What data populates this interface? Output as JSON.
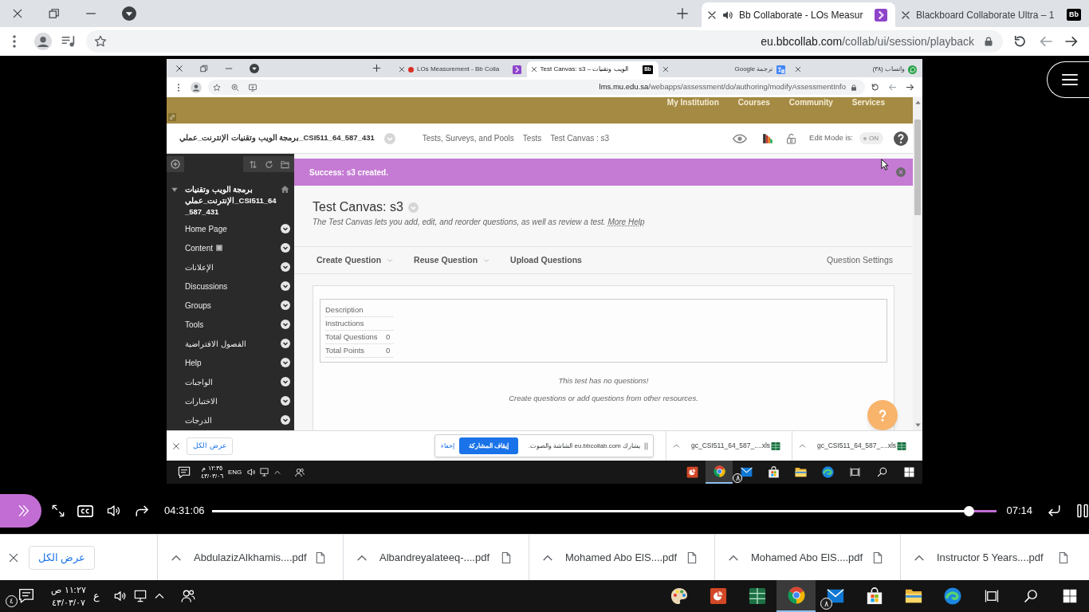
{
  "browser": {
    "tabs": [
      {
        "kind": "blackboard",
        "logo": "Bb",
        "title": "Blackboard Collaborate Ultra – 1",
        "audio": false,
        "selected": false
      },
      {
        "kind": "collab",
        "title": "Bb Collaborate - LOs Measur",
        "audio": true,
        "selected": true
      }
    ],
    "address": {
      "host": "eu.bbcollab.com",
      "path": "/collab/ui/session/playback"
    }
  },
  "shared_screen": {
    "browser": {
      "tabs": [
        {
          "kind": "chat",
          "title": "واتساب (٣٨)",
          "recording": false,
          "selected": false
        },
        {
          "kind": "translate",
          "title": "ترجمة Google",
          "recording": false,
          "selected": false
        },
        {
          "kind": "blackboard",
          "logo": "Bb",
          "title": "Test Canvas: s3 – الويب وتقنيات",
          "recording": false,
          "selected": true
        },
        {
          "kind": "collab",
          "title": "LOs Measurement - Bb Colla",
          "recording": true,
          "selected": false
        }
      ],
      "address": {
        "host": "lms.mu.edu.sa",
        "path": "/webapps/assessment/do/authoring/modifyAssessmentInfo"
      }
    },
    "page": {
      "top_nav": [
        "Services",
        "Community",
        "Courses",
        "My Institution"
      ],
      "breadcrumbs": [
        {
          "kind": "page",
          "label": "Test Canvas : s3"
        },
        {
          "kind": "page",
          "label": "Tests"
        },
        {
          "kind": "page",
          "label": "Tests, Surveys, and Pools"
        },
        {
          "kind": "course",
          "label": "برمجة الويب وتقنيات الإنترنت_عملي_CSI511_64_587_431"
        }
      ],
      "edit_mode": {
        "label": "Edit Mode is:",
        "value": "ON"
      },
      "sidebar": {
        "course_title": "برمجة الويب وتقنيات الإنترنت_عملي_CSI511_64_587_431",
        "items": [
          {
            "label": "Home Page",
            "hidden": false
          },
          {
            "label": "Content",
            "hidden": true
          },
          {
            "label": "الإعلانات",
            "hidden": false
          },
          {
            "label": "Discussions",
            "hidden": false
          },
          {
            "label": "Groups",
            "hidden": false
          },
          {
            "label": "Tools",
            "hidden": false
          },
          {
            "label": "الفصول الافتراضية",
            "hidden": false
          },
          {
            "label": "Help",
            "hidden": false
          },
          {
            "label": "الواجبات",
            "hidden": false
          },
          {
            "label": "الاختبارات",
            "hidden": false
          },
          {
            "label": "الدرجات",
            "hidden": false
          }
        ]
      },
      "notice": "Success: s3 created.",
      "title": "Test Canvas: s3",
      "description": "The Test Canvas lets you add, edit, and reorder questions, as well as review a test.",
      "help_link": "More Help",
      "actions": [
        {
          "label": "Upload Questions",
          "dropdown": false
        },
        {
          "label": "Reuse Question",
          "dropdown": true
        },
        {
          "label": "Create Question",
          "dropdown": true
        }
      ],
      "settings_link": "Question Settings",
      "details": [
        {
          "label": "Description"
        },
        {
          "label": "Instructions"
        },
        {
          "label": "Total Questions",
          "value": "0"
        },
        {
          "label": "Total Points",
          "value": "0"
        }
      ],
      "empty_title": "This test has no questions!",
      "empty_hint": "Create questions or add questions from other resources."
    },
    "downloads": {
      "show_all": "عرض الكل",
      "sharing": {
        "hide": "إخفاء",
        "stop": "إيقاف المشاركة",
        "message": "يشارك eu.bbcollab.com الشاشة والصوت."
      },
      "files": [
        "gc_CSI511_64_587_....xls",
        "gc_CSI511_64_587_....xls"
      ]
    },
    "taskbar": {
      "time": "١٢:٣٥ م",
      "date": "٤٣/٠٣/٠٦",
      "language": "ENG",
      "apps": [
        {
          "kind": "presentation",
          "selected": false
        },
        {
          "kind": "browser",
          "selected": true
        },
        {
          "kind": "mail",
          "badge": "٨",
          "selected": false
        },
        {
          "kind": "store",
          "selected": false
        },
        {
          "kind": "folder",
          "selected": false
        },
        {
          "kind": "edge",
          "selected": false
        }
      ]
    }
  },
  "player": {
    "elapsed": "04:31:06",
    "level": 0.964,
    "remaining": "07:14",
    "playing": true
  },
  "downloads": {
    "show_all": "عرض الكل",
    "files": [
      "Instructor 5 Years....pdf",
      "Mohamed Abo ElS....pdf",
      "Mohamed Abo ElS....pdf",
      "Albandreyalateeq-....pdf",
      "AbdulazizAlkhamis....pdf"
    ]
  },
  "taskbar": {
    "time": "١١:٢٧ ص",
    "date": "٤٣/٠٣/٠٧",
    "language": "ع",
    "notifications": "٤",
    "apps": [
      {
        "kind": "paint",
        "selected": false
      },
      {
        "kind": "presentation",
        "selected": false
      },
      {
        "kind": "spreadsheet",
        "selected": false
      },
      {
        "kind": "browser",
        "selected": true
      },
      {
        "kind": "mail",
        "badge": "٨",
        "selected": false
      },
      {
        "kind": "store",
        "selected": false
      },
      {
        "kind": "folder",
        "selected": false
      },
      {
        "kind": "edge",
        "selected": false
      }
    ]
  }
}
